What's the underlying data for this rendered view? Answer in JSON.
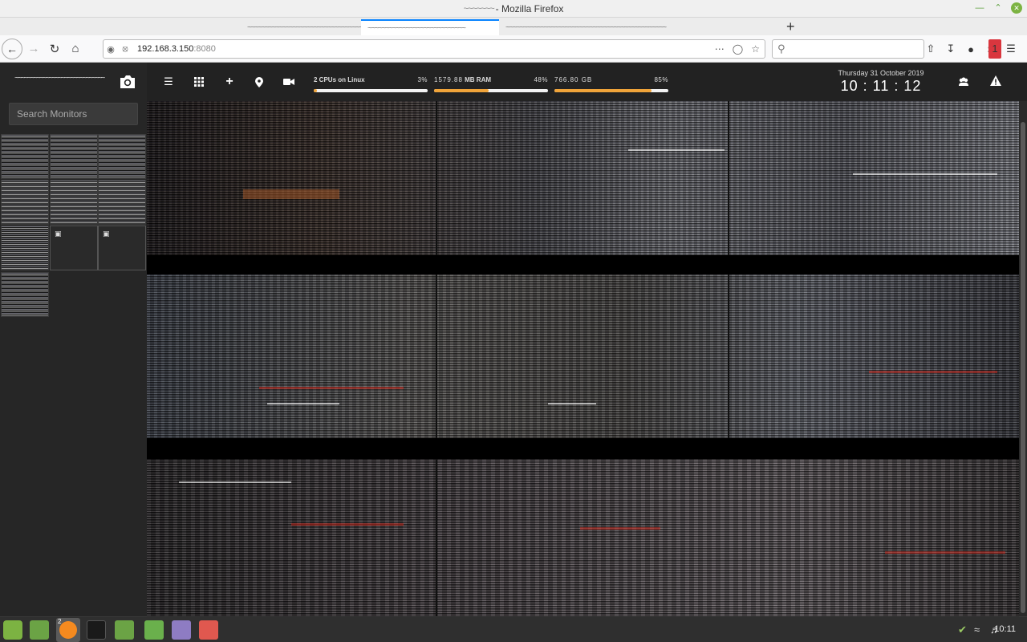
{
  "window": {
    "title": "- Mozilla Firefox",
    "title_prefix_scribble": "~~~~~~~"
  },
  "tabs": [
    {
      "label": "~~~~~~~~~~~~~~~~~~~~~~~~~~~~~~~~~~~",
      "active": false
    },
    {
      "label": "~~~~~~~~~~~~~~~~~~~~~~~~~~~~",
      "active": true
    },
    {
      "label": "~~~~~~~~~~~~~~~~~~~~~~~~~~~~~~~~~~~~~~~~~~~~~~",
      "active": false
    }
  ],
  "navbar": {
    "url_host": "192.168.3.150",
    "url_port": ":8080",
    "search_placeholder": "",
    "extension_badge": "1"
  },
  "sidebar": {
    "brand": "~~~~~~~~~~~~~~~~~~~~~~~~~~~~~",
    "search_placeholder": "Search Monitors"
  },
  "stats": [
    {
      "label": "2 CPUs on Linux",
      "bold": true,
      "percent_text": "3%",
      "fraction": 0.03
    },
    {
      "label": "1579.88",
      "label_suffix": " MB RAM",
      "bold": false,
      "percent_text": "48%",
      "fraction": 0.48
    },
    {
      "label": "766.80 GB",
      "bold": false,
      "percent_text": "85%",
      "fraction": 0.85
    }
  ],
  "clock": {
    "date": "Thursday 31 October 2019",
    "time": "10 : 11 : 12"
  },
  "taskbar": {
    "time": "10:11",
    "firefox_badge": "2"
  },
  "colors": {
    "accent": "#f0a43a",
    "page_bg": "#222222",
    "sidebar_bg": "#262626",
    "mint_green": "#7cb342"
  },
  "icons": [
    "snapshot-camera-icon",
    "menu-icon",
    "grid-icon",
    "add-icon",
    "map-pin-icon",
    "video-camera-icon",
    "users-icon",
    "alert-icon"
  ]
}
